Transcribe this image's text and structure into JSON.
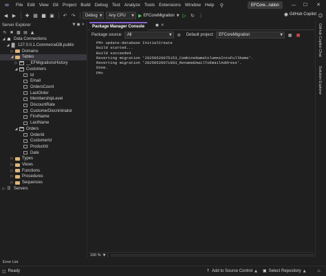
{
  "menu": {
    "items": [
      "File",
      "Edit",
      "View",
      "Git",
      "Project",
      "Build",
      "Debug",
      "Test",
      "Analyze",
      "Tools",
      "Extensions",
      "Window",
      "Help"
    ],
    "solution_name": "EFCore...ration"
  },
  "toolbar": {
    "configuration": "Debug",
    "platform": "Any CPU",
    "startup_project": "EFCoreMigration",
    "copilot_label": "GitHub Copilot"
  },
  "server_explorer": {
    "title": "Server Explorer",
    "tree": [
      {
        "label": "Data Connections",
        "level": 0,
        "toggle": "open",
        "icon": "database"
      },
      {
        "label": "127.0.0.1.CommerceDB.public",
        "level": 1,
        "toggle": "open",
        "icon": "connection"
      },
      {
        "label": "Domains",
        "level": 2,
        "toggle": "closed",
        "icon": "folder"
      },
      {
        "label": "Tables",
        "level": 2,
        "toggle": "open",
        "icon": "folder",
        "selected": true
      },
      {
        "label": "__EFMigrationsHistory",
        "level": 3,
        "toggle": "closed",
        "icon": "table"
      },
      {
        "label": "Customers",
        "level": 3,
        "toggle": "open",
        "icon": "table"
      },
      {
        "label": "Id",
        "level": 4,
        "toggle": "",
        "icon": "column"
      },
      {
        "label": "Email",
        "level": 4,
        "toggle": "",
        "icon": "column"
      },
      {
        "label": "OrdersCount",
        "level": 4,
        "toggle": "",
        "icon": "column"
      },
      {
        "label": "LastOrder",
        "level": 4,
        "toggle": "",
        "icon": "column"
      },
      {
        "label": "MembershipLevel",
        "level": 4,
        "toggle": "",
        "icon": "column"
      },
      {
        "label": "DiscountRate",
        "level": 4,
        "toggle": "",
        "icon": "column"
      },
      {
        "label": "CustomerDiscriminator",
        "level": 4,
        "toggle": "",
        "icon": "column"
      },
      {
        "label": "FirstName",
        "level": 4,
        "toggle": "",
        "icon": "column"
      },
      {
        "label": "LastName",
        "level": 4,
        "toggle": "",
        "icon": "column"
      },
      {
        "label": "Orders",
        "level": 3,
        "toggle": "open",
        "icon": "table"
      },
      {
        "label": "OrderId",
        "level": 4,
        "toggle": "",
        "icon": "column"
      },
      {
        "label": "CustomerId",
        "level": 4,
        "toggle": "",
        "icon": "column"
      },
      {
        "label": "ProductId",
        "level": 4,
        "toggle": "",
        "icon": "column"
      },
      {
        "label": "Date",
        "level": 4,
        "toggle": "",
        "icon": "column"
      },
      {
        "label": "Types",
        "level": 2,
        "toggle": "closed",
        "icon": "folder"
      },
      {
        "label": "Views",
        "level": 2,
        "toggle": "closed",
        "icon": "folder"
      },
      {
        "label": "Functions",
        "level": 2,
        "toggle": "closed",
        "icon": "folder"
      },
      {
        "label": "Procedures",
        "level": 2,
        "toggle": "closed",
        "icon": "folder"
      },
      {
        "label": "Sequences",
        "level": 2,
        "toggle": "closed",
        "icon": "folder"
      },
      {
        "label": "Servers",
        "level": 0,
        "toggle": "closed",
        "icon": "server"
      }
    ]
  },
  "pmc": {
    "tab_title": "Package Manager Console",
    "source_label": "Package source:",
    "source_value": "All",
    "default_project_label": "Default project:",
    "default_project_value": "EFCoreMigration",
    "output": [
      "PM> update-database InitialCreate",
      "Build started...",
      "Build succeeded.",
      "Reverting migration '20250520075153_CombineNameColumnsIntoFullName'.",
      "Reverting migration '20250520071803_RenameEmailToEmailAddress'.",
      "Done.",
      "PM>"
    ],
    "zoom": "100 %"
  },
  "right_strip": {
    "tabs": [
      "GitHub Copilot Chat",
      "Solution Explorer"
    ]
  },
  "bottom": {
    "error_list": "Error List"
  },
  "status": {
    "ready": "Ready",
    "source_control": "Add to Source Control",
    "repository": "Select Repository"
  }
}
